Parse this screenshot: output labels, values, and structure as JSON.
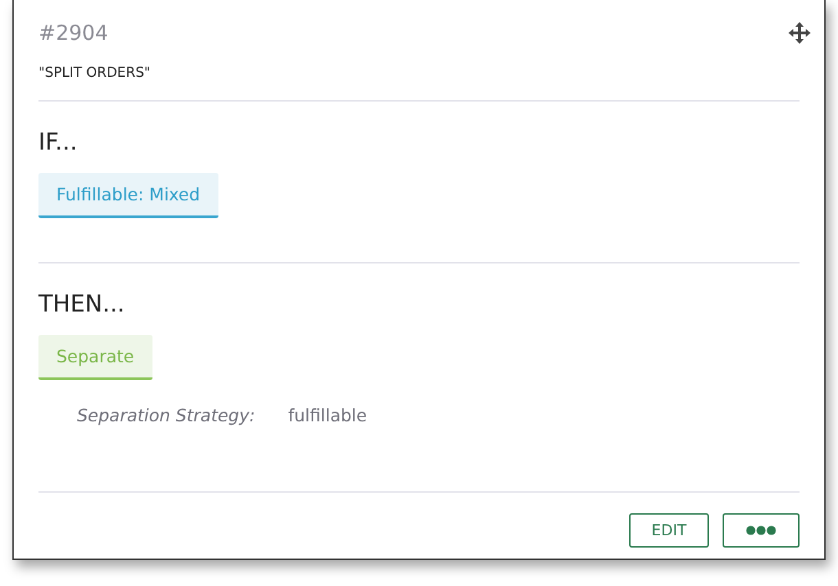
{
  "rule": {
    "number": "#2904",
    "name": "\"SPLIT ORDERS\""
  },
  "sections": [
    {
      "heading": "IF...",
      "chips": [
        {
          "kind": "condition",
          "label": "Fulfillable: Mixed"
        }
      ]
    },
    {
      "heading": "THEN...",
      "chips": [
        {
          "kind": "action",
          "label": "Separate"
        }
      ],
      "details": [
        {
          "label": "Separation Strategy:",
          "value": "fulfillable"
        }
      ]
    }
  ],
  "footer": {
    "edit_label": "EDIT"
  }
}
